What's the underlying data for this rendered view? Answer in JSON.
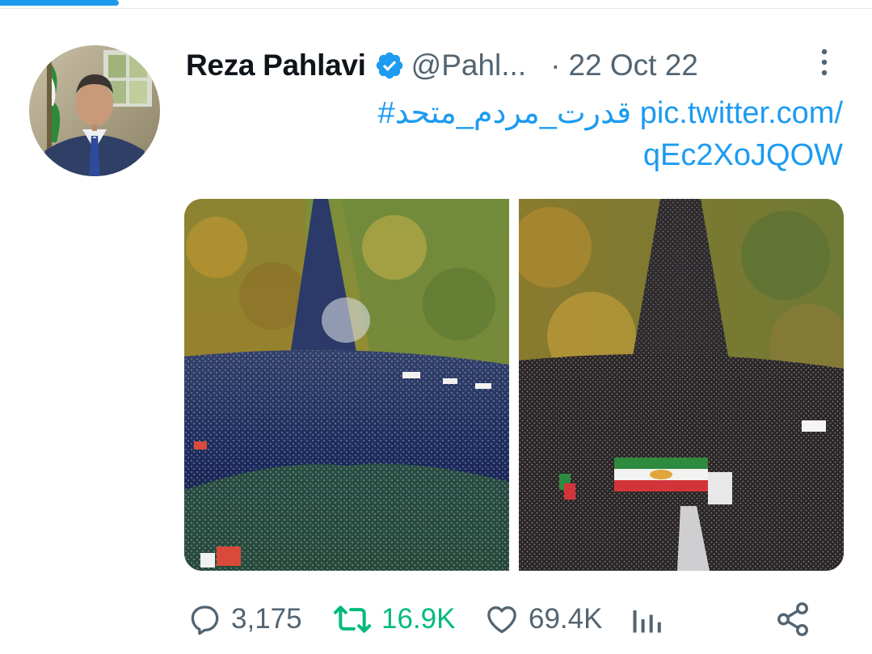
{
  "loading_bar": {
    "progress_fraction": 0.136,
    "color": "#1d9bf0"
  },
  "tweet": {
    "author_name": "Reza Pahlavi",
    "handle": "@Pahl...",
    "separator": "·",
    "date": "22 Oct 22",
    "verified": true,
    "text_line1": "#قدرت_مردم_متحد pic.twitter.com/",
    "text_line2": "qEc2XoJQOW",
    "link_color": "#1d9bf0"
  },
  "media": {
    "photos": [
      {
        "name": "aerial-crowd-photo-left"
      },
      {
        "name": "aerial-crowd-photo-right"
      }
    ]
  },
  "actions": {
    "replies": "3,175",
    "retweets": "16.9K",
    "likes": "69.4K",
    "colors": {
      "default": "#536471",
      "retweet": "#00ba7c"
    }
  }
}
